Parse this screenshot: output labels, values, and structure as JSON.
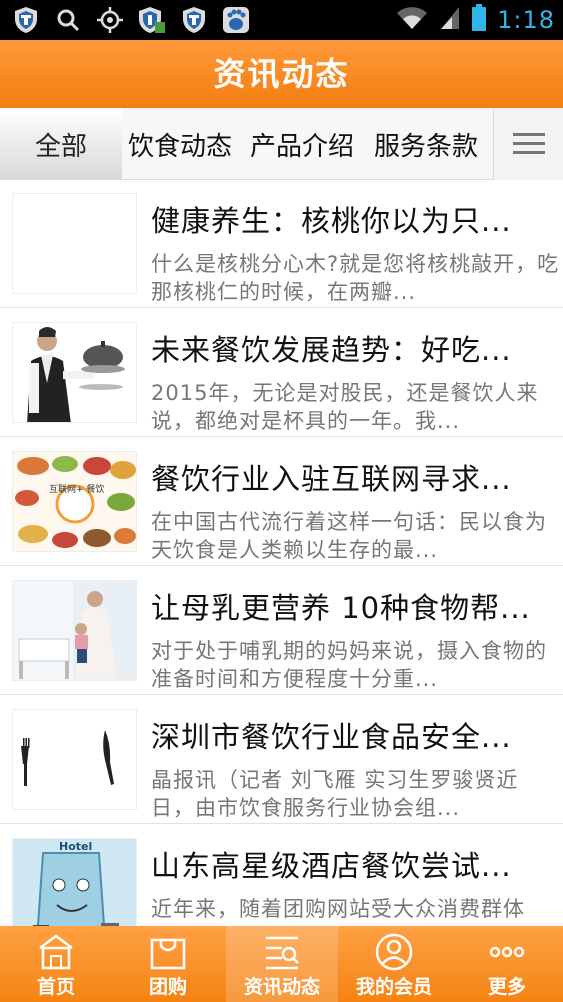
{
  "status_bar": {
    "time": "1:18",
    "icons": [
      "shield-icon",
      "search-icon",
      "gps-icon",
      "shield-app-icon",
      "shield-icon",
      "baidu-icon",
      "wifi-icon",
      "signal-icon",
      "battery-icon"
    ]
  },
  "header": {
    "title": "资讯动态"
  },
  "tabs": {
    "items": [
      {
        "label": "全部",
        "active": true
      },
      {
        "label": "饮食动态",
        "active": false
      },
      {
        "label": "产品介绍",
        "active": false
      },
      {
        "label": "服务条款",
        "active": false
      }
    ],
    "more_icon": "menu-icon"
  },
  "articles": [
    {
      "title": "健康养生：核桃你以为只...",
      "desc": "什么是核桃分心木?就是您将核桃敲开，吃那核桃仁的时候，在两瓣..."
    },
    {
      "title": "未来餐饮发展趋势：好吃...",
      "desc": "2015年，无论是对股民，还是餐饮人来说，都绝对是杯具的一年。我..."
    },
    {
      "title": "餐饮行业入驻互联网寻求...",
      "desc": "在中国古代流行着这样一句话：民以食为天饮食是人类赖以生存的最...",
      "image_text": "互联网+ 餐饮"
    },
    {
      "title": "让母乳更营养 10种食物帮...",
      "desc": "对于处于哺乳期的妈妈来说，摄入食物的准备时间和方便程度十分重..."
    },
    {
      "title": "深圳市餐饮行业食品安全...",
      "desc": "晶报讯（记者 刘飞雁 实习生罗骏贤近日，由市饮食服务行业协会组..."
    },
    {
      "title": "山东高星级酒店餐饮尝试...",
      "desc": "近年来，随着团购网站受大众消费群体",
      "image_text": "Hotel"
    }
  ],
  "bottom_nav": [
    {
      "label": "首页",
      "icon": "home-icon",
      "active": false
    },
    {
      "label": "团购",
      "icon": "shopping-bag-icon",
      "active": false
    },
    {
      "label": "资讯动态",
      "icon": "news-icon",
      "active": true
    },
    {
      "label": "我的会员",
      "icon": "member-icon",
      "active": false
    },
    {
      "label": "更多",
      "icon": "more-icon",
      "active": false
    }
  ],
  "colors": {
    "accent": "#f58313",
    "status_time": "#2fb5e6"
  }
}
